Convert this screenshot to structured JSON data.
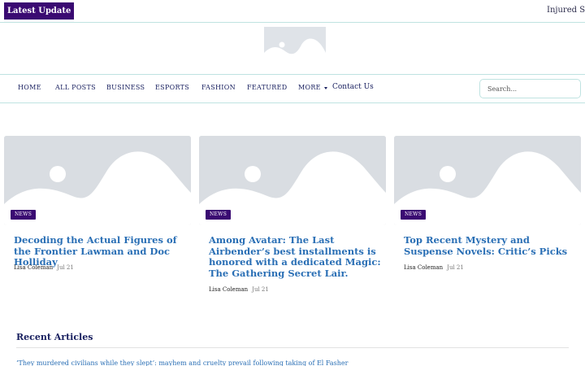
{
  "ticker": {
    "badge": "Latest Update",
    "text": "Injured Se"
  },
  "logo": {
    "icon": "image-placeholder-icon"
  },
  "nav": {
    "items": [
      "HOME",
      "ALL POSTS",
      "BUSINESS",
      "ESPORTS",
      "FASHION",
      "FEATURED",
      "MORE"
    ],
    "contact": "Contact Us",
    "search_placeholder": "Search..."
  },
  "cards": [
    {
      "badge": "NEWS",
      "title": "Decoding the Actual Figures of the Frontier Lawman and Doc Holliday",
      "author": "Lisa Coleman",
      "date": "Jul 21"
    },
    {
      "badge": "NEWS",
      "title": "Among Avatar: The Last Airbender’s best installments is honored with a dedicated Magic: The Gathering Secret Lair.",
      "author": "Lisa Coleman",
      "date": "Jul 21"
    },
    {
      "badge": "NEWS",
      "title": "Top Recent Mystery and Suspense Novels: Critic’s Picks",
      "author": "Lisa Coleman",
      "date": "Jul 21"
    }
  ],
  "recent": {
    "title": "Recent Articles",
    "items": [
      "‘They murdered civilians while they slept’: mayhem and cruelty prevail following taking of El Fasher"
    ]
  },
  "colors": {
    "accent": "#3a0a72",
    "link": "#2a6fb5",
    "nav_text": "#1a2160",
    "divider": "#bfe3e1"
  }
}
